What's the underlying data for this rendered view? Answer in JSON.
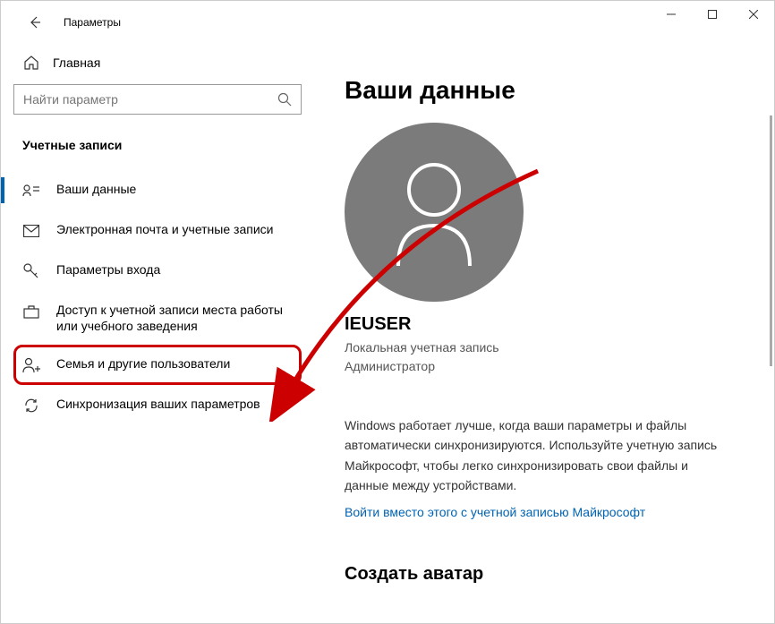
{
  "window": {
    "title": "Параметры"
  },
  "sidebar": {
    "home": "Главная",
    "search_placeholder": "Найти параметр",
    "category": "Учетные записи",
    "items": [
      {
        "label": "Ваши данные"
      },
      {
        "label": "Электронная почта и учетные записи"
      },
      {
        "label": "Параметры входа"
      },
      {
        "label": "Доступ к учетной записи места работы или учебного заведения"
      },
      {
        "label": "Семья и другие пользователи"
      },
      {
        "label": "Синхронизация ваших параметров"
      }
    ]
  },
  "main": {
    "page_title": "Ваши данные",
    "username": "IEUSER",
    "account_type_1": "Локальная учетная запись",
    "account_type_2": "Администратор",
    "description": "Windows работает лучше, когда ваши параметры и файлы автоматически синхронизируются. Используйте учетную запись Майкрософт, чтобы легко синхронизировать свои файлы и данные между устройствами.",
    "signin_link": "Войти вместо этого с учетной записью Майкрософт",
    "create_avatar": "Создать аватар"
  }
}
